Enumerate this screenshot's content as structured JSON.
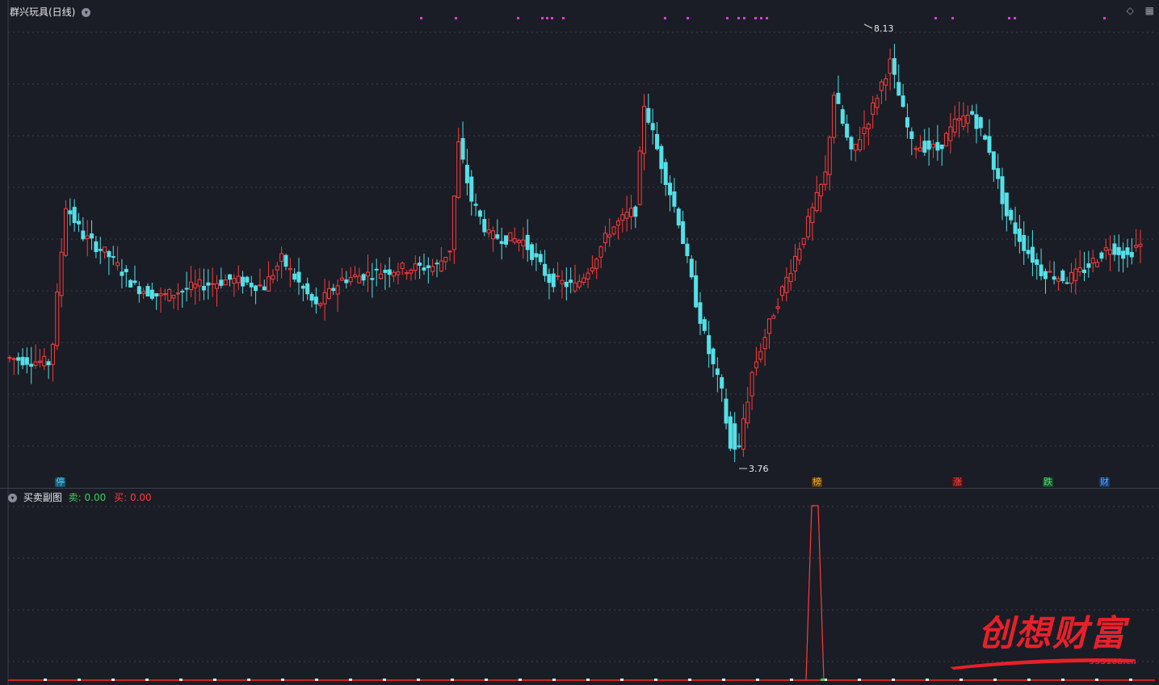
{
  "main": {
    "title": "群兴玩具(日线)",
    "high_label": "8.13",
    "low_label": "3.76",
    "markers": [
      {
        "text": "停",
        "color": "#5ac8fa",
        "bg": "#0e5a6e"
      },
      {
        "text": "榜",
        "color": "#f0b040",
        "bg": "#5a3a10"
      },
      {
        "text": "涨",
        "color": "#ff4d4d",
        "bg": "#5a1515"
      },
      {
        "text": "跌",
        "color": "#55e07a",
        "bg": "#12502a"
      },
      {
        "text": "财",
        "color": "#5aa8ff",
        "bg": "#153a6a"
      }
    ]
  },
  "sub": {
    "title": "买卖副图",
    "sell_label": "卖:",
    "sell_value": "0.00",
    "buy_label": "买:",
    "buy_value": "0.00"
  },
  "watermark": {
    "brand": "创想财富",
    "url": "995168.cn"
  },
  "colors": {
    "up": "#ff3b3b",
    "down": "#54e0e8",
    "magenta": "#e03be0",
    "grid": "#3a3f4a"
  }
}
